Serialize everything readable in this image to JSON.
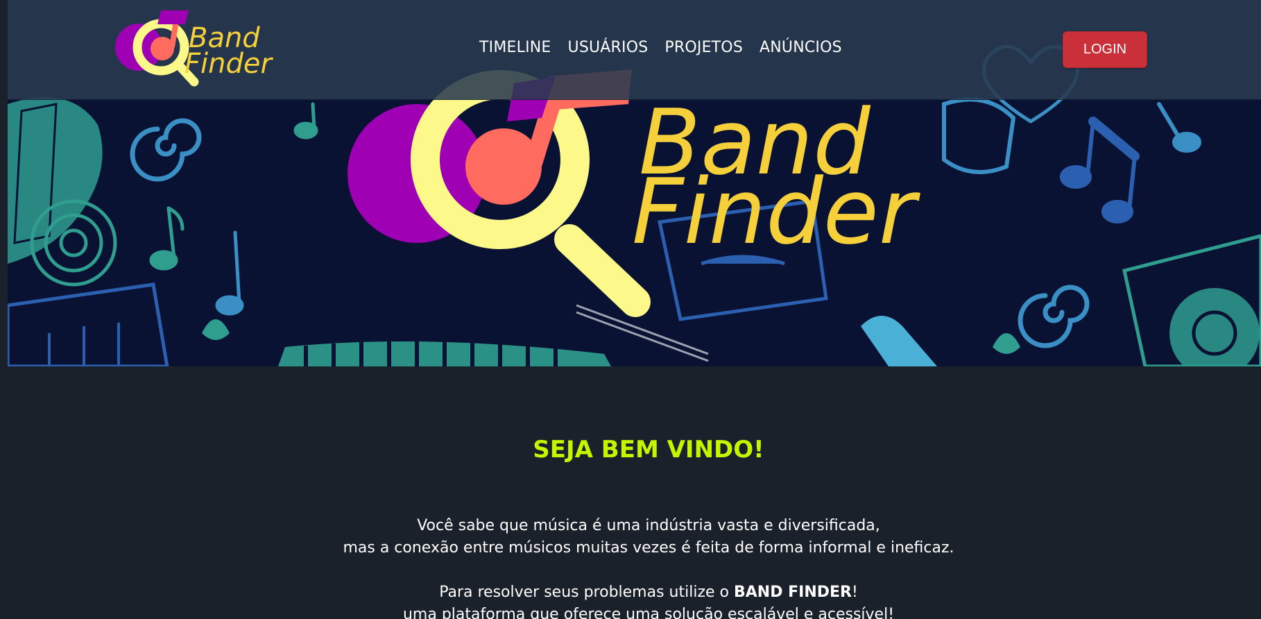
{
  "brand": {
    "logo_line1": "Band",
    "logo_line2": "Finder",
    "colors": {
      "purple": "#a000b4",
      "yellow_ring": "#fcf88a",
      "coral_note": "#ff6b5f",
      "gold_text": "#f5d03a"
    }
  },
  "navbar": {
    "links": [
      {
        "label": "TIMELINE"
      },
      {
        "label": "USUÁRIOS"
      },
      {
        "label": "PROJETOS"
      },
      {
        "label": "ANÚNCIOS"
      }
    ],
    "login_label": "LOGIN",
    "colors": {
      "background": "#283a50",
      "login": "#c9303a"
    }
  },
  "hero": {
    "background_color": "#0a1234",
    "doodle_colors": [
      "#3a8fc4",
      "#2f9e8f",
      "#2b5fb0",
      "#4bb0d6"
    ]
  },
  "welcome": {
    "title": "SEJA BEM VINDO!",
    "line1": "Você sabe que música é uma indústria vasta e diversificada,",
    "line2": "mas a conexão entre músicos muitas vezes é feita de forma informal e ineficaz.",
    "line3_prefix": "Para resolver seus problemas utilize o ",
    "line3_brand": "BAND FINDER",
    "line3_suffix": "!",
    "line4": "uma plataforma que oferece uma solução escalável e acessível!",
    "colors": {
      "title": "#c6f500",
      "text": "#ffffff",
      "background": "#1b212a"
    }
  }
}
